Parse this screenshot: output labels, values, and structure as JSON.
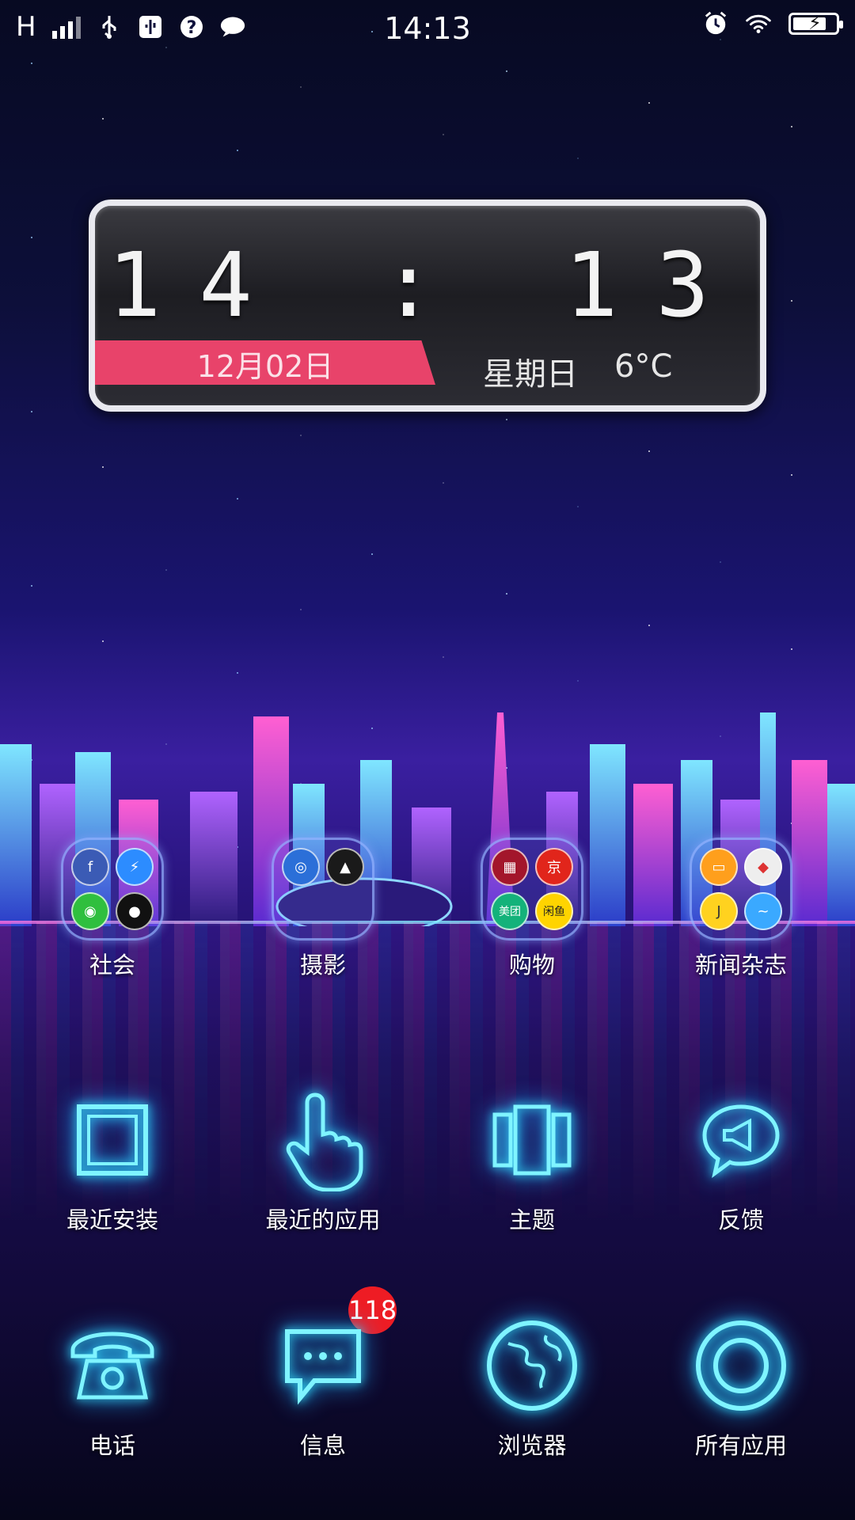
{
  "status_bar": {
    "network": "H",
    "time": "14:13",
    "icons_left": [
      "signal-icon",
      "usb-icon",
      "usb-debug-icon",
      "help-icon",
      "message-icon"
    ],
    "icons_right": [
      "alarm-icon",
      "wifi-icon",
      "battery-charging-icon"
    ]
  },
  "clock_widget": {
    "hours": "14",
    "minutes": "13",
    "date": "12月02日",
    "weekday": "星期日",
    "temperature": "6°C",
    "ribbon_color": "#e8436a"
  },
  "folders": [
    {
      "label": "社会",
      "apps": [
        "facebook",
        "messenger",
        "wechat",
        "qq"
      ]
    },
    {
      "label": "摄影",
      "apps": [
        "camera",
        "snapseed"
      ]
    },
    {
      "label": "购物",
      "apps": [
        "shopping-cart",
        "jd",
        "美团",
        "闲鱼"
      ]
    },
    {
      "label": "新闻杂志",
      "apps": [
        "books",
        "news",
        "headline",
        "feed"
      ]
    }
  ],
  "row2": [
    {
      "label": "最近安装",
      "icon": "square-icon"
    },
    {
      "label": "最近的应用",
      "icon": "pointing-hand-icon"
    },
    {
      "label": "主题",
      "icon": "theme-cards-icon"
    },
    {
      "label": "反馈",
      "icon": "megaphone-bubble-icon"
    }
  ],
  "dock": [
    {
      "label": "电话",
      "icon": "telephone-icon"
    },
    {
      "label": "信息",
      "icon": "message-icon",
      "badge": "118"
    },
    {
      "label": "浏览器",
      "icon": "globe-icon"
    },
    {
      "label": "所有应用",
      "icon": "ring-icon"
    }
  ],
  "accent_color": "#34e6ff"
}
